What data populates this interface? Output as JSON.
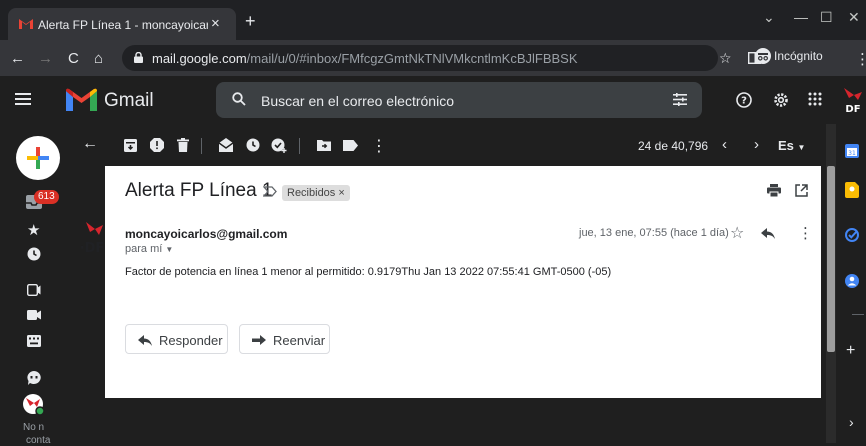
{
  "browser": {
    "tab_title": "Alerta FP Línea 1 - moncayoicarlos",
    "url_domain": "mail.google.com",
    "url_path": "/mail/u/0/#inbox/FMfcgzGmtNkTNlVMkcntlmKcBJlFBBSK",
    "incognito_label": "Incógnito"
  },
  "gmail": {
    "app_name": "Gmail",
    "search_placeholder": "Buscar en el correo electrónico",
    "unread_badge": "613",
    "pagination": "24 de 40,796",
    "language": "Es",
    "rail_bottom_label_1": "No n",
    "rail_bottom_label_2": "conta"
  },
  "email": {
    "subject": "Alerta FP Línea 1",
    "label": "Recibidos ×",
    "sender": "moncayoicarlos@gmail.com",
    "recipient": "para mí",
    "date": "jue, 13 ene, 07:55 (hace 1 día)",
    "body": "Factor de potencia en línea 1 menor al permitido: 0.9179Thu Jan 13 2022 07:55:41 GMT-0500 (-05)",
    "reply_label": "Responder",
    "forward_label": "Reenviar",
    "avatar_text": "DF"
  },
  "colors": {
    "gmail_red": "#ea4335",
    "brand_red": "#d6252d",
    "badge_red": "#d93025"
  }
}
